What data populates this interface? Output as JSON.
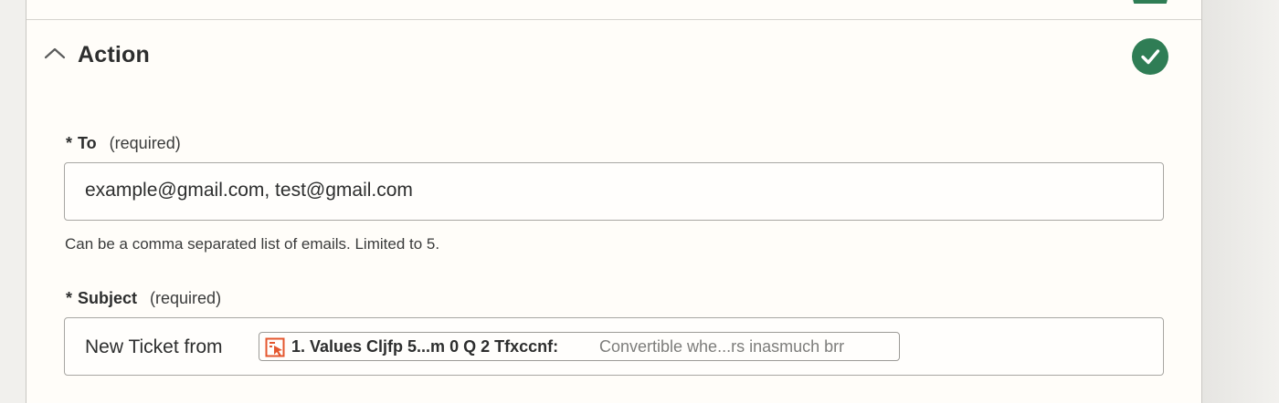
{
  "section": {
    "title": "Action",
    "status": "complete"
  },
  "fields": {
    "to": {
      "star": "*",
      "label": "To",
      "required_text": "(required)",
      "value": "example@gmail.com, test@gmail.com",
      "help": "Can be a comma separated list of emails. Limited to 5."
    },
    "subject": {
      "star": "*",
      "label": "Subject",
      "required_text": "(required)",
      "prefix": "New Ticket from",
      "pill": {
        "key": "1. Values Cljfp 5...m 0 Q 2 Tfxccnf:",
        "value": "Convertible whe...rs inasmuch brr",
        "icon": "form-trigger-icon"
      }
    }
  },
  "colors": {
    "success": "#2f7d55",
    "pill_icon": "#e4572e",
    "panel_bg": "#fffdf9"
  },
  "icons": {
    "collapse": "chevron-up-icon",
    "status": "check-circle-icon"
  }
}
